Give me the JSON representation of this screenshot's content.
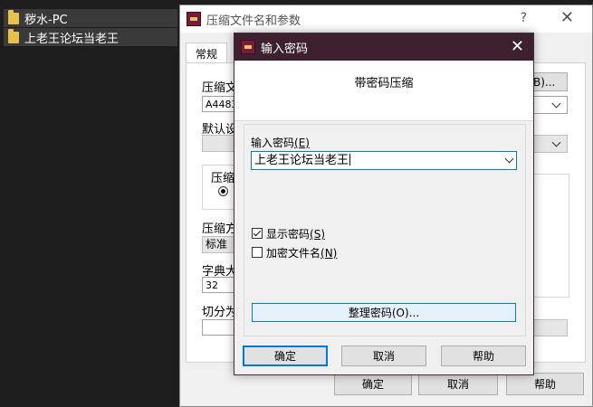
{
  "explorer": {
    "items": [
      {
        "label": "秽水-PC"
      },
      {
        "label": "上老王论坛当老王"
      }
    ]
  },
  "back_dialog": {
    "title": "压缩文件名和参数",
    "help_glyph": "?",
    "close_glyph": "✕",
    "tab_general": "常规",
    "archive_name_label": "压缩文",
    "archive_name_value": "A4483",
    "browse_fragment": "B)...",
    "default_profile_label": "默认设",
    "compress_format_label": "压缩",
    "compress_method_label": "压缩方",
    "compress_method_value": "标准",
    "dict_size_label": "字典大",
    "dict_size_value": "32",
    "split_label": "切分为",
    "ok_label": "确定",
    "cancel_label": "取消",
    "help_label": "帮助"
  },
  "password_dialog": {
    "title": "输入密码",
    "close_glyph": "✕",
    "heading": "带密码压缩",
    "enter_label": "输入密码",
    "enter_hotkey": "(E)",
    "password_value": "上老王论坛当老王",
    "show_password": {
      "label": "显示密码",
      "hotkey": "(S)",
      "checked": true
    },
    "encrypt_names": {
      "label": "加密文件名",
      "hotkey": "(N)",
      "checked": false
    },
    "organize_label": "整理密码",
    "organize_hotkey": "(O)...",
    "ok_label": "确定",
    "cancel_label": "取消",
    "help_label": "帮助"
  },
  "colors": {
    "password_titlebar": "#3e2131",
    "accent": "#0078d7",
    "explorer_bg": "#1e1e1e"
  }
}
